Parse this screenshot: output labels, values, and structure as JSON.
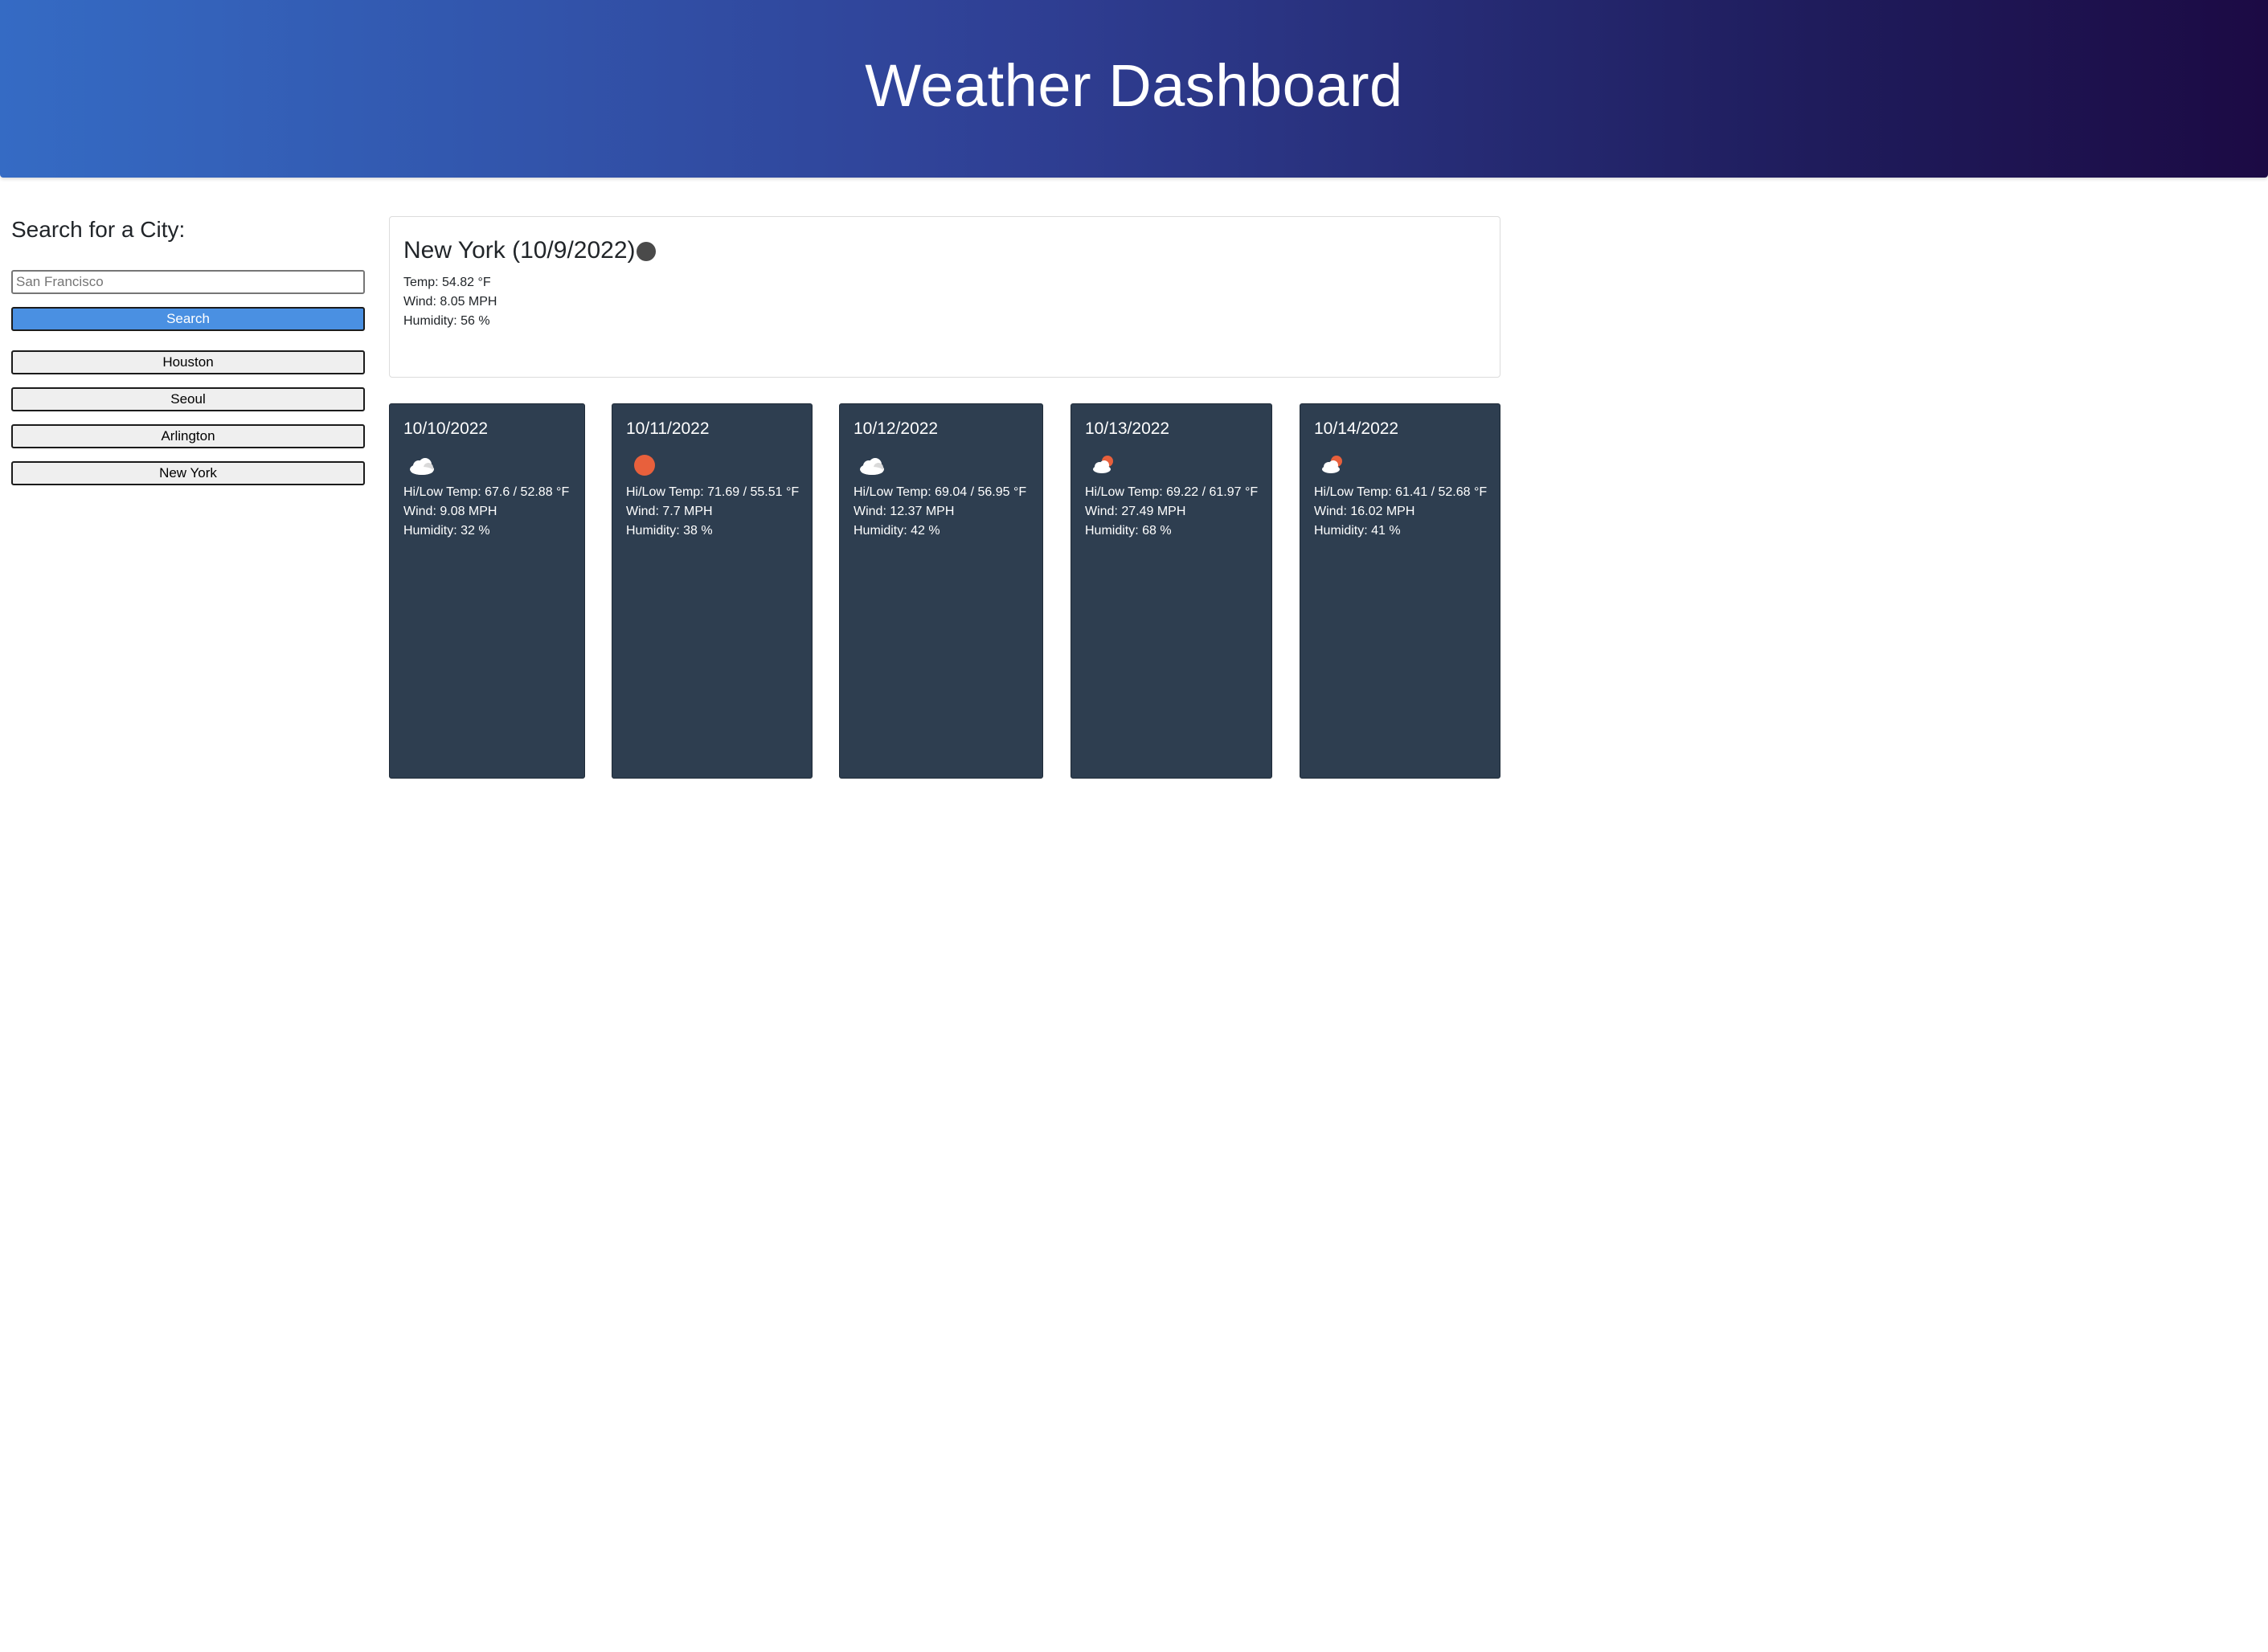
{
  "header": {
    "title": "Weather Dashboard",
    "gradient_colors": [
      "#356bc4",
      "#2f3f94",
      "#1f1c5c",
      "#1c0a44"
    ]
  },
  "sidebar": {
    "heading": "Search for a City:",
    "search_placeholder": "San Francisco",
    "search_button_label": "Search",
    "search_button_color": "#4a90e2",
    "history": [
      "Houston",
      "Seoul",
      "Arlington",
      "New York"
    ]
  },
  "current": {
    "title": "New York (10/9/2022)",
    "icon": "dark-cloud-icon",
    "temp": "Temp: 54.82 °F",
    "wind": "Wind: 8.05 MPH",
    "humidity": "Humidity: 56 %"
  },
  "forecast": [
    {
      "date": "10/10/2022",
      "icon": "cloud-icon",
      "hilow": "Hi/Low Temp: 67.6 / 52.88 °F",
      "wind": "Wind: 9.08 MPH",
      "humidity": "Humidity: 32 %"
    },
    {
      "date": "10/11/2022",
      "icon": "sun-icon",
      "hilow": "Hi/Low Temp: 71.69 / 55.51 °F",
      "wind": "Wind: 7.7 MPH",
      "humidity": "Humidity: 38 %"
    },
    {
      "date": "10/12/2022",
      "icon": "cloud-icon",
      "hilow": "Hi/Low Temp: 69.04 / 56.95 °F",
      "wind": "Wind: 12.37 MPH",
      "humidity": "Humidity: 42 %"
    },
    {
      "date": "10/13/2022",
      "icon": "partly-cloudy-icon",
      "hilow": "Hi/Low Temp: 69.22 / 61.97 °F",
      "wind": "Wind: 27.49 MPH",
      "humidity": "Humidity: 68 %"
    },
    {
      "date": "10/14/2022",
      "icon": "partly-cloudy-icon",
      "hilow": "Hi/Low Temp: 61.41 / 52.68 °F",
      "wind": "Wind: 16.02 MPH",
      "humidity": "Humidity: 41 %"
    }
  ],
  "colors": {
    "card_bg": "#2e3e50",
    "sun": "#e8603c",
    "dark_cloud": "#4a4a4a",
    "cloud": "#ffffff"
  }
}
